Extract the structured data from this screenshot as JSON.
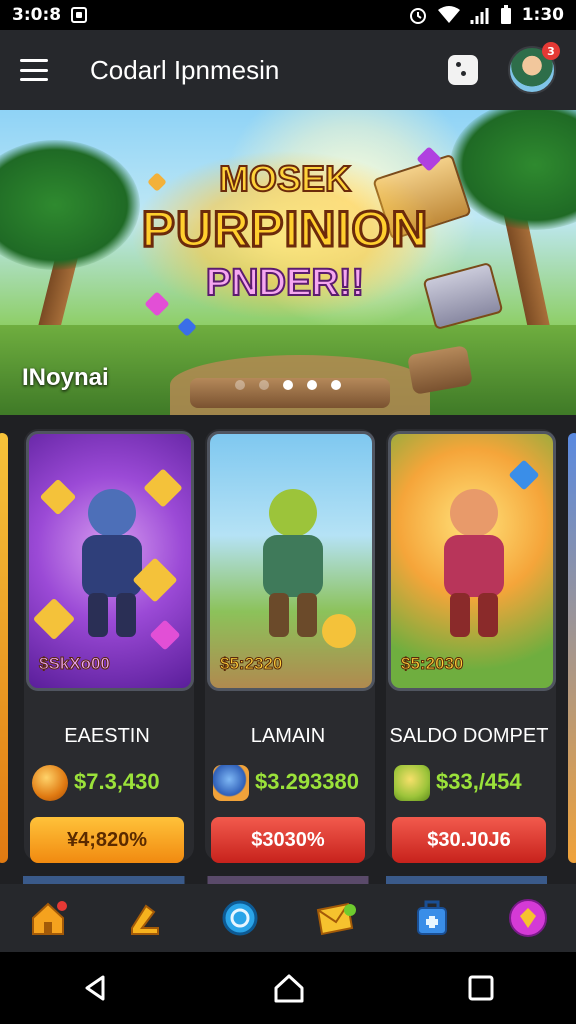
{
  "status_bar": {
    "time": "3:0:8",
    "right_time": "1:30"
  },
  "app_bar": {
    "title": "Codarl Ipnmesin",
    "avatar_badge": "3"
  },
  "banner": {
    "title_line1": "MOSEK",
    "title_line2": "PURPINION",
    "title_line3": "PNDER!!",
    "label": "INoynai",
    "active_dot": 2
  },
  "cards": [
    {
      "art_price": "$SkXo00",
      "name": "EAESTIN",
      "amount": "$7.3,430",
      "button": "¥4;820%",
      "button_style": "orange"
    },
    {
      "art_price": "$5:2320",
      "name": "LAMAIN",
      "amount": "$3.293380",
      "button": "$3030%",
      "button_style": "red"
    },
    {
      "art_price": "$5:2030",
      "name": "SALDO DOMPET",
      "amount": "$33,/454",
      "button": "$30.J0J6",
      "button_style": "red"
    }
  ],
  "bottom_nav": [
    "home-icon",
    "trophy-icon",
    "compass-icon",
    "mail-icon",
    "store-icon",
    "gem-icon"
  ],
  "colors": {
    "accent_green": "#9be23a",
    "button_orange": "#f18a10",
    "button_red": "#c7221c",
    "app_bar": "#26282c"
  }
}
